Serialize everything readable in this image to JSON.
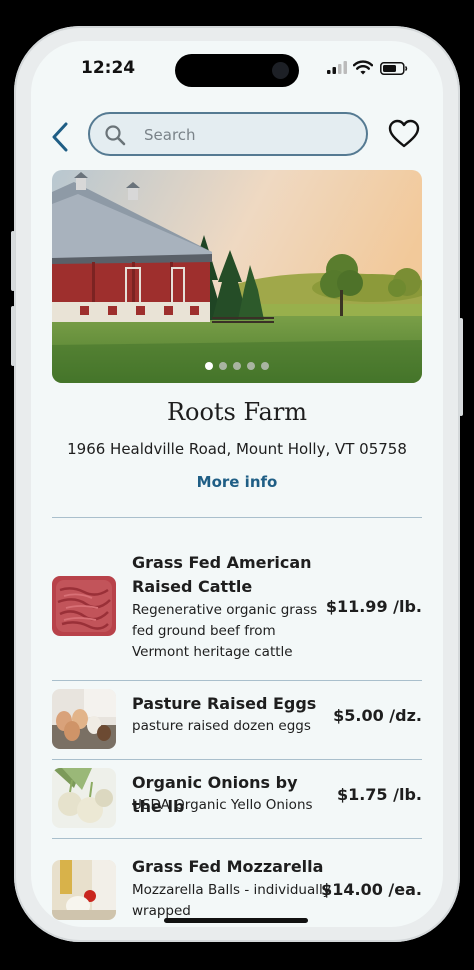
{
  "status_bar": {
    "time": "12:24"
  },
  "search": {
    "placeholder": "Search"
  },
  "farm": {
    "name": "Roots Farm",
    "address": "1966 Healdville Road, Mount Holly, VT 05758",
    "more_info": "More info"
  },
  "carousel": {
    "count": 5,
    "active_index": 0
  },
  "products": [
    {
      "name": "Grass Fed American Raised Cattle",
      "description": "Regenerative organic grass fed ground beef from Vermont heritage cattle",
      "price": "$11.99 /lb."
    },
    {
      "name": "Pasture Raised Eggs",
      "description": "pasture raised dozen eggs",
      "price": "$5.00 /dz."
    },
    {
      "name": "Organic Onions by the lb",
      "description": "USDA Organic Yello Onions",
      "price": "$1.75 /lb."
    },
    {
      "name": "Grass Fed Mozzarella",
      "description": "Mozzarella Balls - individually wrapped",
      "price": "$14.00 /ea."
    }
  ],
  "colors": {
    "accent": "#1f5e85",
    "search_border": "#557a92",
    "background": "#f3f8f8",
    "divider": "#a9bfcc"
  },
  "icons": [
    "back-chevron-icon",
    "search-icon",
    "heart-icon",
    "signal-icon",
    "wifi-icon",
    "battery-icon"
  ]
}
